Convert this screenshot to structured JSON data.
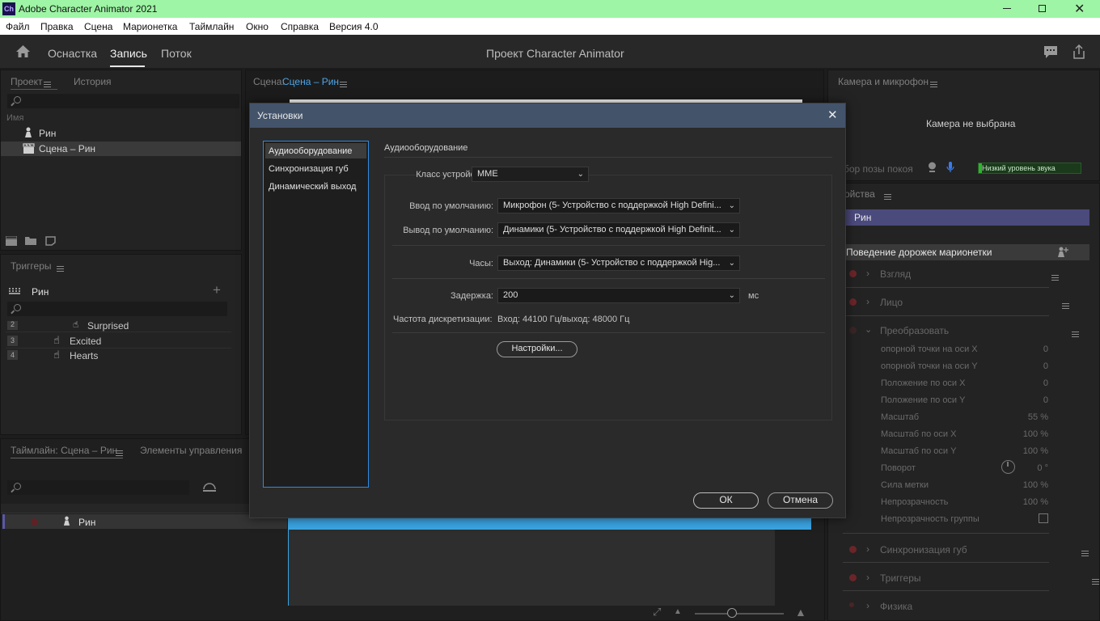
{
  "window": {
    "app_icon": "Ch",
    "title": "Adobe Character Animator 2021"
  },
  "menu": [
    "Файл",
    "Правка",
    "Сцена",
    "Марионетка",
    "Таймлайн",
    "Окно",
    "Справка",
    "Версия 4.0"
  ],
  "workspaces": {
    "rig": "Оснастка",
    "record": "Запись",
    "stream": "Поток"
  },
  "project_title": "Проект Character Animator",
  "project_panel": {
    "tab_project": "Проект",
    "tab_history": "История",
    "column_name": "Имя",
    "items": [
      "Рин",
      "Сцена – Рин"
    ]
  },
  "triggers_panel": {
    "title": "Триггеры",
    "puppet": "Рин",
    "rows": [
      {
        "num": "2",
        "label": "Surprised"
      },
      {
        "num": "3",
        "label": "Excited"
      },
      {
        "num": "4",
        "label": "Hearts"
      }
    ]
  },
  "timeline_panel": {
    "tab_timeline": "Таймлайн: Сцена – Рин",
    "tab_controls": "Элементы управления",
    "track": "Рин"
  },
  "scene_panel": {
    "label": "Сцена:",
    "scene": "Сцена – Рин"
  },
  "camera_panel": {
    "title": "Камера и микрофон",
    "no_camera": "Камера не выбрана",
    "rest_pose": "бор позы покоя",
    "sound_level": "Низкий уровень звука"
  },
  "properties_panel": {
    "title": "ойства",
    "puppet": "Рин",
    "behaviors_header": "Поведение дорожек марионетки",
    "behavior_gaze": "Взгляд",
    "behavior_face": "Лицо",
    "behavior_transform": "Преобразовать",
    "transform_rows": [
      {
        "label": "опорной точки на оси X",
        "value": "0"
      },
      {
        "label": "опорной точки на оси Y",
        "value": "0"
      },
      {
        "label": "Положение по оси X",
        "value": "0"
      },
      {
        "label": "Положение по оси Y",
        "value": "0"
      },
      {
        "label": "Масштаб",
        "value": "55 %"
      },
      {
        "label": "Масштаб по оси X",
        "value": "100 %"
      },
      {
        "label": "Масштаб по оси Y",
        "value": "100 %"
      },
      {
        "label": "Поворот",
        "value": "0 °"
      },
      {
        "label": "Сила метки",
        "value": "100 %"
      },
      {
        "label": "Непрозрачность",
        "value": "100 %"
      },
      {
        "label": "Непрозрачность группы",
        "value": ""
      }
    ],
    "behavior_lipsync": "Синхронизация губ",
    "behavior_triggers": "Триггеры",
    "behavior_physics": "Физика"
  },
  "dialog": {
    "title": "Установки",
    "nav": [
      "Аудиооборудование",
      "Синхронизация губ",
      "Динамический выход"
    ],
    "section_title": "Аудиооборудование",
    "device_class_label": "Класс устройства:",
    "device_class_value": "MME",
    "default_input_label": "Ввод по умолчанию:",
    "default_input_value": "Микрофон (5- Устройство с поддержкой High Defini...",
    "default_output_label": "Вывод по умолчанию:",
    "default_output_value": "Динамики (5- Устройство с поддержкой High Definit...",
    "clock_label": "Часы:",
    "clock_value": "Выход: Динамики (5- Устройство с поддержкой Hig...",
    "latency_label": "Задержка:",
    "latency_value": "200",
    "latency_unit": "мс",
    "sample_rate_label": "Частота дискретизации:",
    "sample_rate_value": "Вход: 44100 Гц/выход: 48000 Гц",
    "settings_button": "Настройки...",
    "ok_button": "ОК",
    "cancel_button": "Отмена"
  },
  "colors": {
    "titlebar": "#9ef5a5",
    "accent": "#3aa3e0",
    "dialog_title": "#43536a",
    "puppet_highlight": "#4b4a7c",
    "record_red": "#b3242b"
  }
}
